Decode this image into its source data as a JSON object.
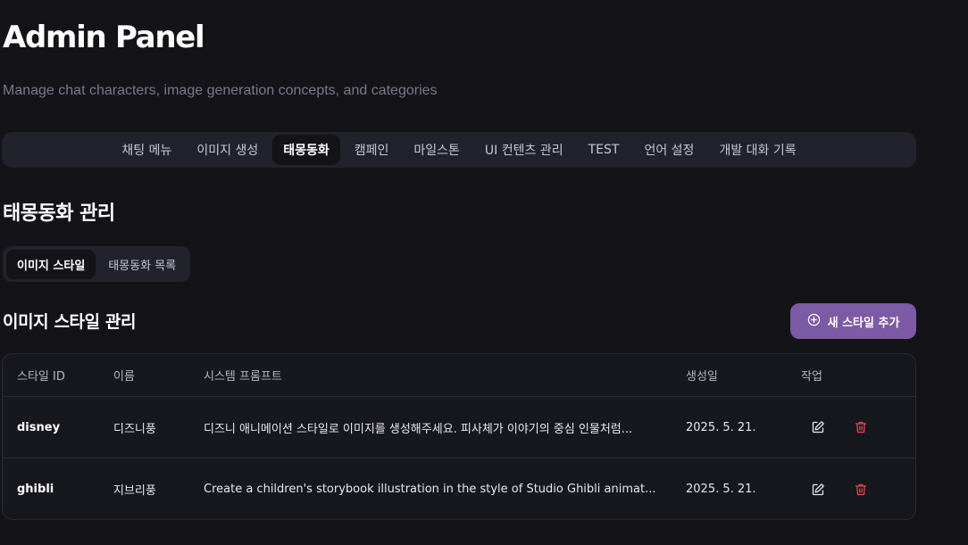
{
  "header": {
    "title": "Admin Panel",
    "subtitle": "Manage chat characters, image generation concepts, and categories"
  },
  "nav": {
    "tabs": [
      {
        "label": "채팅 메뉴"
      },
      {
        "label": "이미지 생성"
      },
      {
        "label": "태몽동화",
        "active": true
      },
      {
        "label": "캠페인"
      },
      {
        "label": "마일스톤"
      },
      {
        "label": "UI 컨텐츠 관리"
      },
      {
        "label": "TEST"
      },
      {
        "label": "언어 설정"
      },
      {
        "label": "개발 대화 기록"
      }
    ]
  },
  "section": {
    "title": "태몽동화 관리",
    "subtabs": [
      {
        "label": "이미지 스타일",
        "active": true
      },
      {
        "label": "태몽동화 목록"
      }
    ]
  },
  "styles": {
    "heading": "이미지 스타일 관리",
    "add_button_label": "새 스타일 추가",
    "add_icon": "plus-circle-icon",
    "columns": {
      "id": "스타일 ID",
      "name": "이름",
      "prompt": "시스템 프롬프트",
      "created": "생성일",
      "actions": "작업"
    },
    "rows": [
      {
        "id": "disney",
        "name": "디즈니풍",
        "prompt": "디즈니 애니메이션 스타일로 이미지를 생성해주세요. 피사체가 이야기의 중심 인물처럼...",
        "created": "2025. 5. 21."
      },
      {
        "id": "ghibli",
        "name": "지브리풍",
        "prompt": "Create a children's storybook illustration in the style of Studio Ghibli animat...",
        "created": "2025. 5. 21."
      }
    ]
  },
  "colors": {
    "background": "#131318",
    "panel": "#22222c",
    "accent": "#7c5aa6",
    "delete": "#e0484f"
  }
}
